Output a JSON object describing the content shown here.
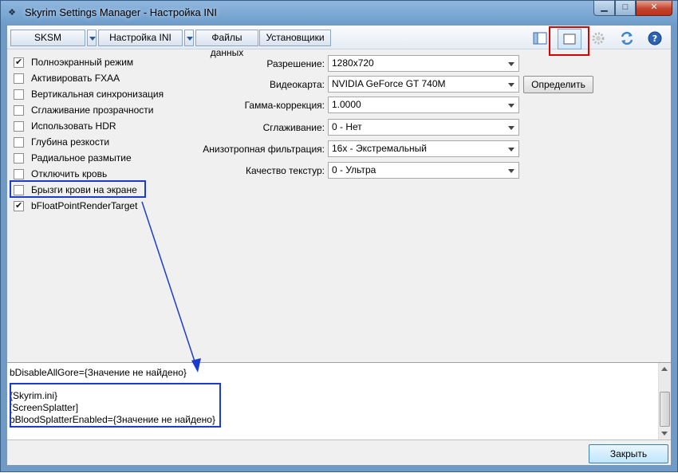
{
  "window": {
    "title": "Skyrim Settings Manager - Настройка INI"
  },
  "toolbar": {
    "tabs": [
      {
        "label": "SKSM"
      },
      {
        "label": "Настройка INI"
      },
      {
        "label": "Файлы данных"
      },
      {
        "label": "Установщики"
      }
    ]
  },
  "options": [
    {
      "label": "Полноэкранный режим",
      "checked": true
    },
    {
      "label": "Активировать FXAA",
      "checked": false
    },
    {
      "label": "Вертикальная синхронизация",
      "checked": false
    },
    {
      "label": "Сглаживание прозрачности",
      "checked": false
    },
    {
      "label": "Использовать HDR",
      "checked": false
    },
    {
      "label": "Глубина резкости",
      "checked": false
    },
    {
      "label": "Радиальное размытие",
      "checked": false
    },
    {
      "label": "Отключить кровь",
      "checked": false
    },
    {
      "label": "Брызги крови на экране",
      "checked": false
    },
    {
      "label": "bFloatPointRenderTarget",
      "checked": true
    }
  ],
  "settings": [
    {
      "label": "Разрешение:",
      "value": "1280x720"
    },
    {
      "label": "Видеокарта:",
      "value": "NVIDIA GeForce GT 740M"
    },
    {
      "label": "Гамма-коррекция:",
      "value": "1.0000"
    },
    {
      "label": "Сглаживание:",
      "value": "0 - Нет"
    },
    {
      "label": "Анизотропная фильтрация:",
      "value": "16x - Экстремальный"
    },
    {
      "label": "Качество текстур:",
      "value": "0 - Ультра"
    }
  ],
  "detect_button": "Определить",
  "output": {
    "lines": [
      "bDisableAllGore={Значение не найдено}",
      "",
      "{Skyrim.ini}",
      "[ScreenSplatter]",
      "bBloodSplatterEnabled={Значение не найдено}"
    ]
  },
  "close_button": "Закрыть",
  "colors": {
    "annotation_red": "#d90000",
    "annotation_blue": "#1b3ccf"
  }
}
